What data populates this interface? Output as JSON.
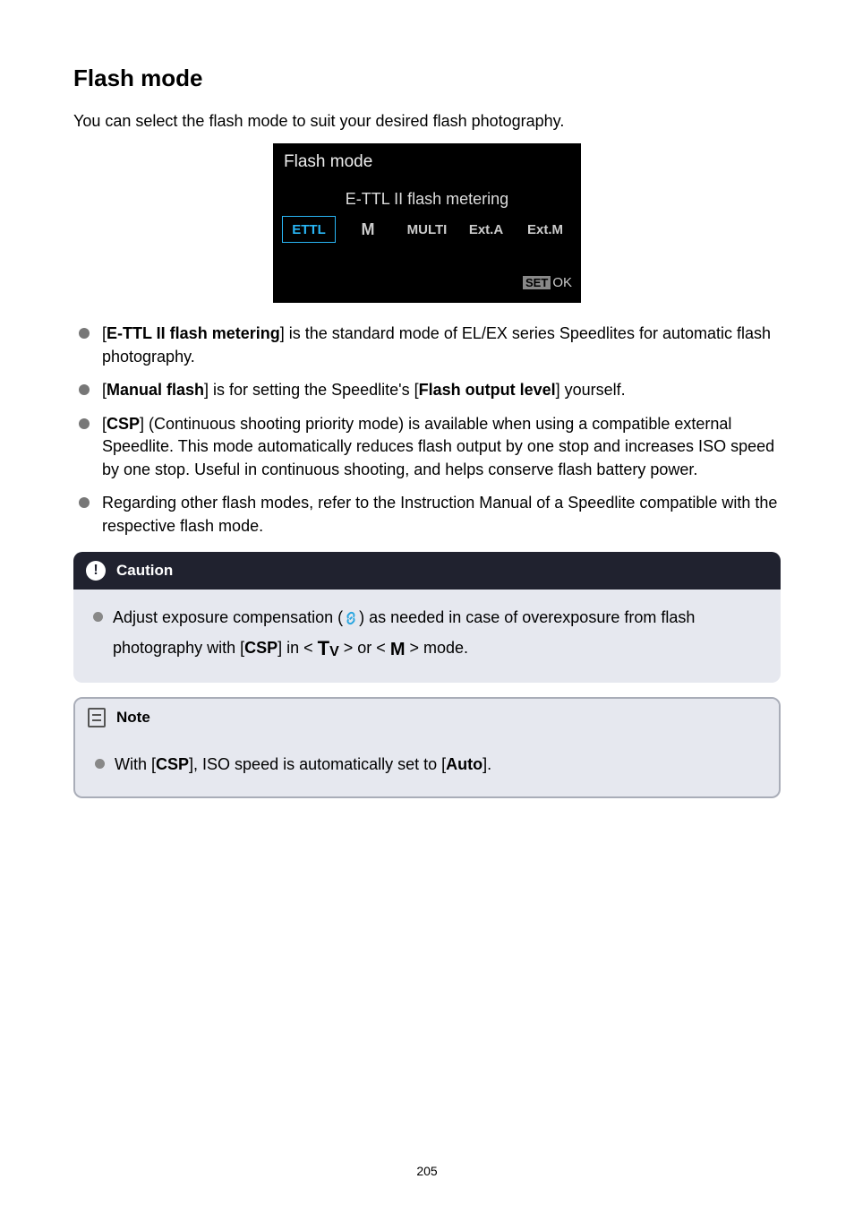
{
  "heading": "Flash mode",
  "intro": "You can select the flash mode to suit your desired flash photography.",
  "camera": {
    "title": "Flash mode",
    "modeLabel": "E-TTL II flash metering",
    "options": [
      "ETTL",
      "M",
      "MULTI",
      "Ext.A",
      "Ext.M"
    ],
    "selectedIndex": 0,
    "setLabel": "SET",
    "okLabel": "OK"
  },
  "bullets": [
    {
      "prefix": "[",
      "bold1": "E-TTL II flash metering",
      "middle": "] is the standard mode of EL/EX series Speedlites for automatic flash photography."
    },
    {
      "prefix": "[",
      "bold1": "Manual flash",
      "middle": "] is for setting the Speedlite's [",
      "bold2": "Flash output level",
      "suffix": "] yourself."
    },
    {
      "prefix": "[",
      "bold1": "CSP",
      "middle": "] (Continuous shooting priority mode) is available when using a compatible external Speedlite. This mode automatically reduces flash output by one stop and increases ISO speed by one stop. Useful in continuous shooting, and helps conserve flash battery power."
    },
    {
      "plain": "Regarding other flash modes, refer to the Instruction Manual of a Speedlite compatible with the respective flash mode."
    }
  ],
  "caution": {
    "title": "Caution",
    "textBefore": "Adjust exposure compensation (",
    "textAfter": ") as needed in case of overexposure from flash photography with [",
    "csp": "CSP",
    "mid2": "] in < ",
    "mid3": " > or < ",
    "end": " > mode."
  },
  "note": {
    "title": "Note",
    "textBefore": "With [",
    "csp": "CSP",
    "mid": "], ISO speed is automatically set to [",
    "auto": "Auto",
    "end": "]."
  },
  "pageNumber": "205"
}
